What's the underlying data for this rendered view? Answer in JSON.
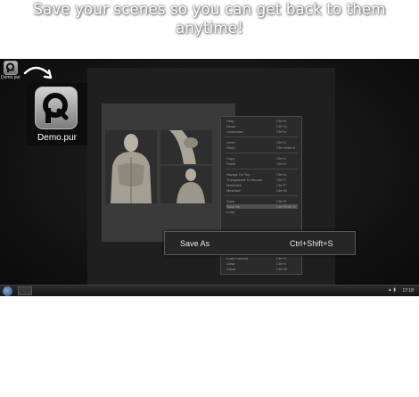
{
  "headline": {
    "line1": "Save your scenes so you can get back to them",
    "line2": "anytime!"
  },
  "desktop": {
    "small_icon_label": "Demo.pur",
    "big_icon_label": "Demo.pur"
  },
  "context_menu": {
    "items": [
      {
        "label": "Help",
        "shortcut": "Ctrl+H"
      },
      {
        "label": "About",
        "shortcut": "Ctrl+Q"
      },
      {
        "label": "Customize",
        "shortcut": "Ctrl+U"
      },
      {
        "label": "Undo",
        "shortcut": "Ctrl+Z"
      },
      {
        "label": "Redo",
        "shortcut": "Ctrl+Shift+Z"
      },
      {
        "label": "Copy",
        "shortcut": "Ctrl+C"
      },
      {
        "label": "Paste",
        "shortcut": "Ctrl+V"
      },
      {
        "label": "Always On Top",
        "shortcut": "Ctrl+A"
      },
      {
        "label": "Transparent To Mouse",
        "shortcut": "Ctrl+T"
      },
      {
        "label": "Maximize",
        "shortcut": "Ctrl+F"
      },
      {
        "label": "Minimize",
        "shortcut": "Ctrl+M"
      },
      {
        "label": "Save",
        "shortcut": "Ctrl+S"
      },
      {
        "label": "Save As",
        "shortcut": "Ctrl+Shift+S"
      },
      {
        "label": "Load",
        "shortcut": ""
      }
    ],
    "lower_items": [
      {
        "label": "Load Camera",
        "shortcut": "Ctrl+G"
      },
      {
        "label": "Clear",
        "shortcut": "Ctrl+X"
      },
      {
        "label": "Close",
        "shortcut": "Ctrl+W"
      }
    ]
  },
  "popup": {
    "label": "Save As",
    "shortcut": "Ctrl+Shift+S"
  },
  "taskbar": {
    "clock": "17:18"
  }
}
